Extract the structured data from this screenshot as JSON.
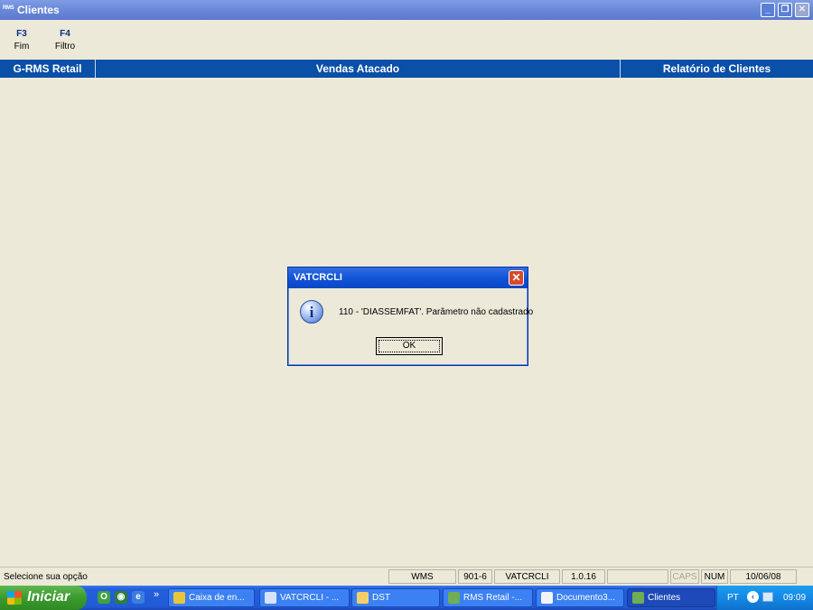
{
  "window": {
    "app_icon_text": "RMS",
    "title": "Clientes"
  },
  "toolbar": {
    "items": [
      {
        "key": "F3",
        "label": "Fim"
      },
      {
        "key": "F4",
        "label": "Filtro"
      }
    ]
  },
  "header": {
    "left": "G-RMS Retail",
    "center": "Vendas Atacado",
    "right": "Relatório de Clientes"
  },
  "dialog": {
    "title": "VATCRCLI",
    "message": "110 - 'DIASSEMFAT'. Parâmetro não cadastrado",
    "ok_label": "OK",
    "icon": "info-icon"
  },
  "statusbar": {
    "message": "Selecione sua opção",
    "fields": [
      "WMS",
      "901-6",
      "VATCRCLI",
      "1.0.16",
      "",
      "CAPS",
      "NUM",
      "10/06/08"
    ]
  },
  "taskbar": {
    "start_label": "Iniciar",
    "overflow": "»",
    "tasks": [
      {
        "label": "Caixa de en..."
      },
      {
        "label": "VATCRCLI - ..."
      },
      {
        "label": "DST"
      },
      {
        "label": "RMS Retail -..."
      },
      {
        "label": "Documento3..."
      },
      {
        "label": "Clientes"
      }
    ],
    "lang": "PT",
    "clock": "09:09"
  }
}
